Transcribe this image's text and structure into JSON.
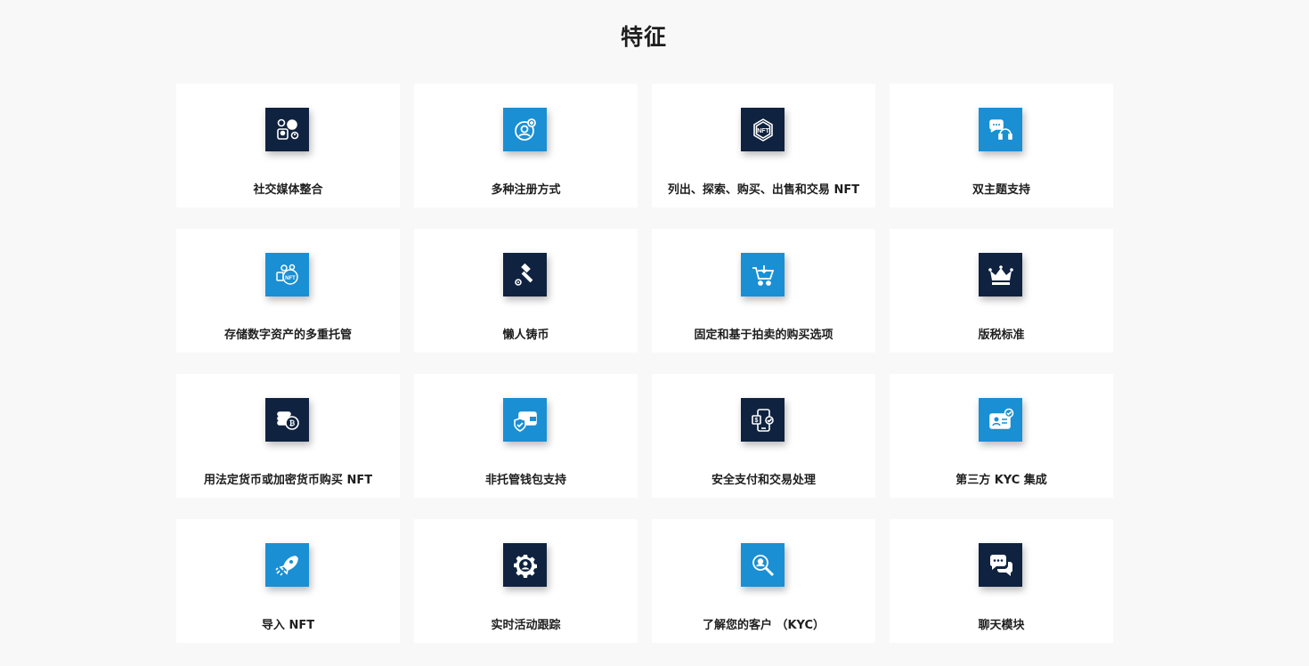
{
  "section": {
    "title": "特征"
  },
  "colors": {
    "navy": "#0f2240",
    "blue": "#1a8fd4",
    "card_bg": "#ffffff",
    "page_bg": "#f8f8f8"
  },
  "features": [
    {
      "label": "社交媒体整合",
      "icon": "social-media-icon",
      "color": "navy"
    },
    {
      "label": "多种注册方式",
      "icon": "user-add-icon",
      "color": "blue"
    },
    {
      "label": "列出、探索、购买、出售和交易 NFT",
      "icon": "nft-hexagon-icon",
      "color": "navy"
    },
    {
      "label": "双主题支持",
      "icon": "support-chat-icon",
      "color": "blue"
    },
    {
      "label": "存储数字资产的多重托管",
      "icon": "nft-coins-icon",
      "color": "blue"
    },
    {
      "label": "懒人铸币",
      "icon": "gavel-icon",
      "color": "navy"
    },
    {
      "label": "固定和基于拍卖的购买选项",
      "icon": "shopping-cart-icon",
      "color": "blue"
    },
    {
      "label": "版税标准",
      "icon": "crown-icon",
      "color": "navy"
    },
    {
      "label": "用法定货币或加密货币购买 NFT",
      "icon": "coin-stack-icon",
      "color": "navy"
    },
    {
      "label": "非托管钱包支持",
      "icon": "wallet-shield-icon",
      "color": "blue"
    },
    {
      "label": "安全支付和交易处理",
      "icon": "mobile-payment-icon",
      "color": "navy"
    },
    {
      "label": "第三方 KYC 集成",
      "icon": "id-card-check-icon",
      "color": "blue"
    },
    {
      "label": "导入 NFT",
      "icon": "rocket-icon",
      "color": "blue"
    },
    {
      "label": "实时活动跟踪",
      "icon": "gear-user-icon",
      "color": "navy"
    },
    {
      "label": "了解您的客户 （KYC）",
      "icon": "magnifier-user-icon",
      "color": "blue"
    },
    {
      "label": "聊天模块",
      "icon": "chat-bubbles-icon",
      "color": "navy"
    }
  ]
}
